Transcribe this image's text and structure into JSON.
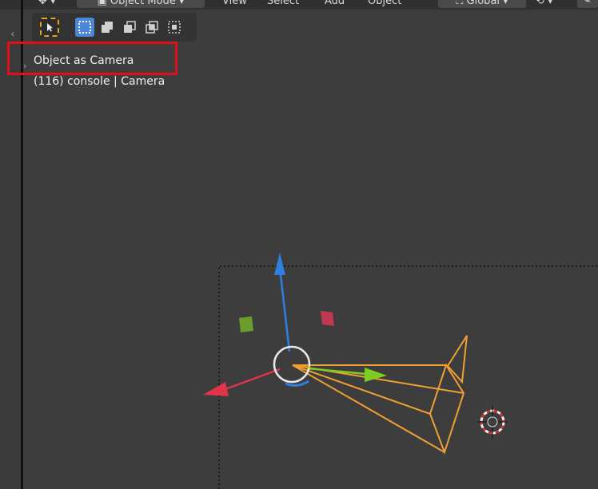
{
  "header": {
    "mode_label": "Object Mode",
    "menu": [
      "View",
      "Select",
      "Add",
      "Object"
    ],
    "transform_orientation": "Global"
  },
  "viewport": {
    "info_title": "Object as Camera",
    "info_subtitle": "(116) console | Camera"
  },
  "icons": {
    "select_tool": "cursor-select-icon",
    "modes": [
      "select-new-icon",
      "select-extend-icon",
      "select-subtract-icon",
      "select-invert-icon",
      "select-intersect-icon"
    ]
  },
  "colors": {
    "viewport_bg": "#3d3d3d",
    "camera_wire": "#f0a030",
    "axis_x": "#e0354a",
    "axis_y": "#7ccc22",
    "axis_z": "#2f7fe0",
    "highlight": "#e0101a",
    "tool_active": "#4d86d9"
  }
}
